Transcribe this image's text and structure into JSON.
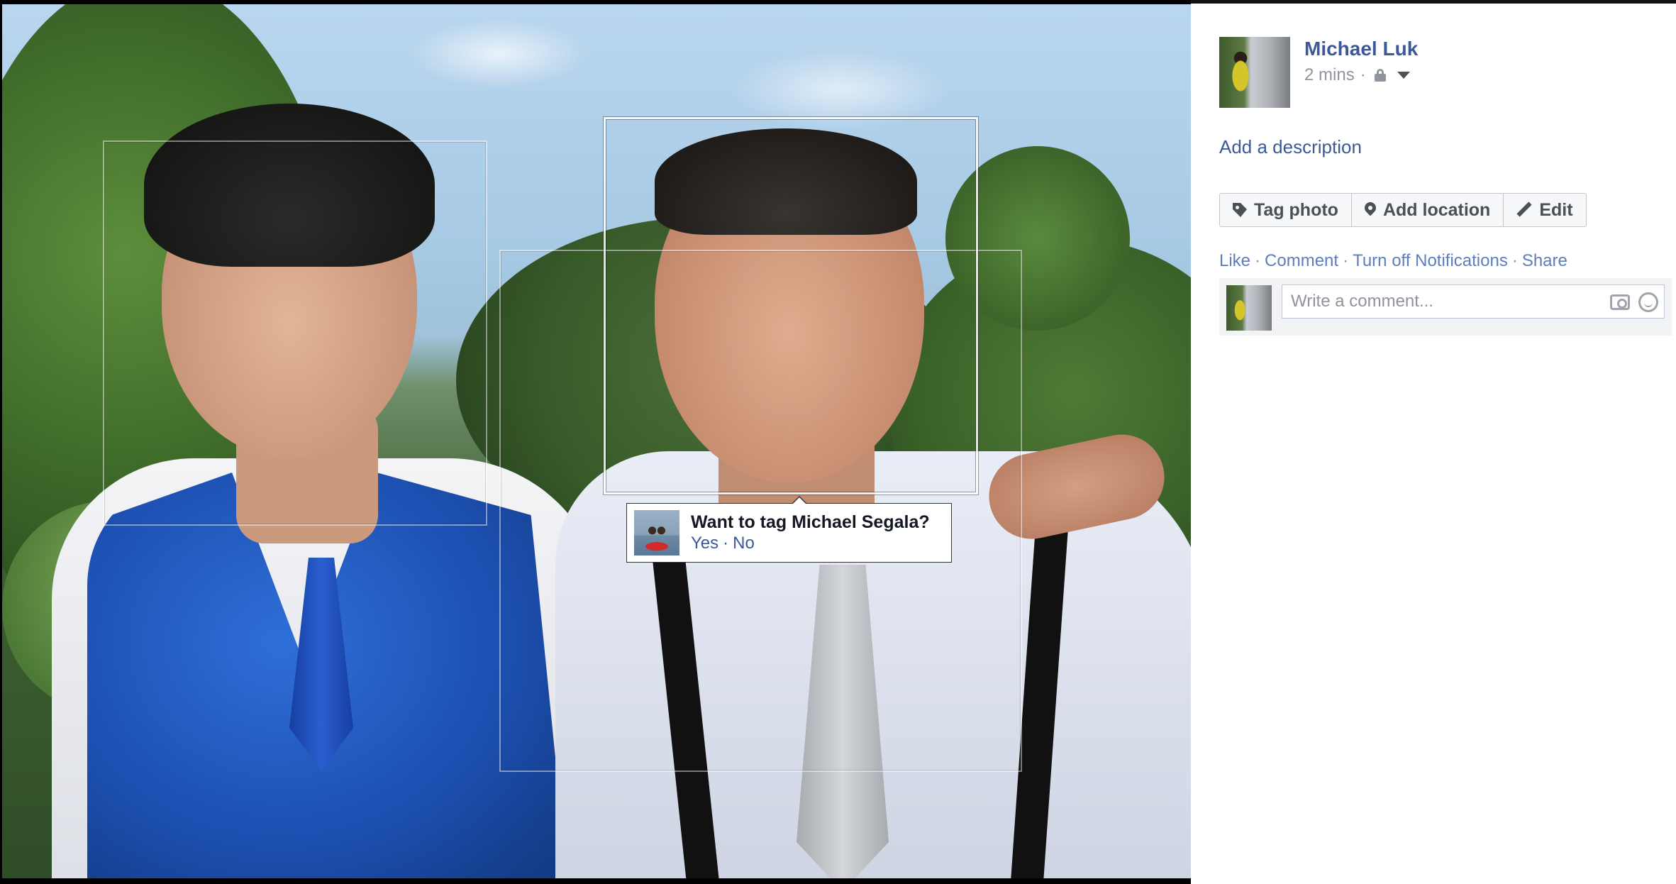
{
  "photo": {
    "tag_suggestion": {
      "question": "Want to tag Michael Segala?",
      "yes_label": "Yes",
      "separator": "·",
      "no_label": "No"
    }
  },
  "post": {
    "author_name": "Michael Luk",
    "timestamp": "2 mins",
    "meta_separator": "·",
    "privacy_icon": "lock-icon",
    "add_description": "Add a description",
    "buttons": {
      "tag_photo": "Tag photo",
      "add_location": "Add location",
      "edit": "Edit"
    },
    "actions": {
      "like": "Like",
      "comment": "Comment",
      "notifications": "Turn off Notifications",
      "share": "Share",
      "separator": "·"
    },
    "comment": {
      "placeholder": "Write a comment..."
    }
  },
  "colors": {
    "link": "#3b5998",
    "muted": "#90949c",
    "button_text": "#4b4f56"
  }
}
